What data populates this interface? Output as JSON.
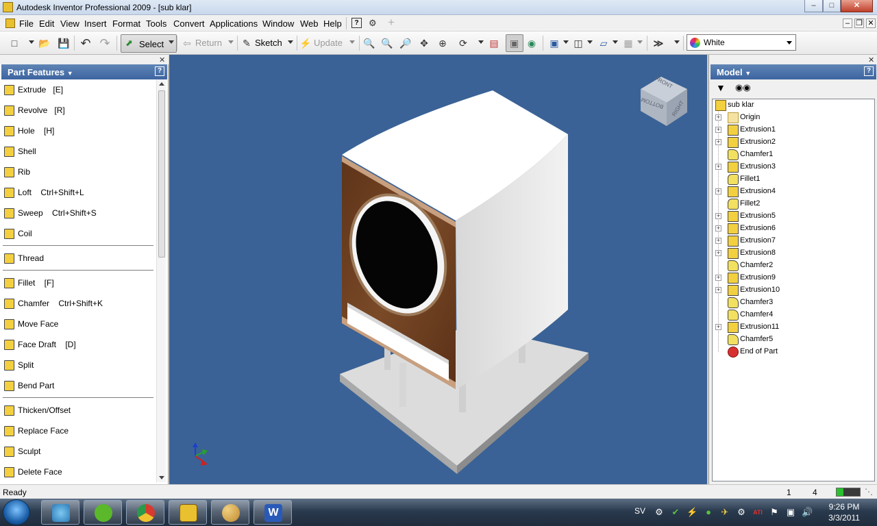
{
  "window": {
    "title": "Autodesk Inventor Professional 2009 - [sub klar]"
  },
  "menubar": {
    "items": [
      "File",
      "Edit",
      "View",
      "Insert",
      "Format",
      "Tools",
      "Convert",
      "Applications",
      "Window",
      "Web",
      "Help"
    ]
  },
  "toolbar": {
    "select_label": "Select",
    "return_label": "Return",
    "sketch_label": "Sketch",
    "update_label": "Update",
    "color_value": "White"
  },
  "left_panel": {
    "title": "Part Features",
    "items": [
      {
        "label": "Extrude   [E]",
        "icon": "extrude-icon"
      },
      {
        "label": "Revolve   [R]",
        "icon": "revolve-icon"
      },
      {
        "label": "Hole    [H]",
        "icon": "hole-icon"
      },
      {
        "label": "Shell",
        "icon": "shell-icon"
      },
      {
        "label": "Rib",
        "icon": "rib-icon"
      },
      {
        "label": "Loft    Ctrl+Shift+L",
        "icon": "loft-icon"
      },
      {
        "label": "Sweep    Ctrl+Shift+S",
        "icon": "sweep-icon"
      },
      {
        "label": "Coil",
        "icon": "coil-icon"
      },
      {
        "label": "Thread",
        "icon": "thread-icon"
      },
      {
        "label": "Fillet    [F]",
        "icon": "fillet-icon"
      },
      {
        "label": "Chamfer    Ctrl+Shift+K",
        "icon": "chamfer-icon"
      },
      {
        "label": "Move Face",
        "icon": "move-face-icon"
      },
      {
        "label": "Face Draft    [D]",
        "icon": "face-draft-icon"
      },
      {
        "label": "Split",
        "icon": "split-icon"
      },
      {
        "label": "Bend Part",
        "icon": "bend-part-icon"
      },
      {
        "label": "Thicken/Offset",
        "icon": "thicken-icon"
      },
      {
        "label": "Replace Face",
        "icon": "replace-face-icon"
      },
      {
        "label": "Sculpt",
        "icon": "sculpt-icon"
      },
      {
        "label": "Delete Face",
        "icon": "delete-face-icon"
      }
    ]
  },
  "viewcube": {
    "faces": [
      "FRONT",
      "RIGHT",
      "BOTTOM"
    ]
  },
  "right_panel": {
    "title": "Model",
    "tree": [
      {
        "label": "sub klar",
        "type": "part"
      },
      {
        "label": "Origin",
        "type": "folder"
      },
      {
        "label": "Extrusion1",
        "type": "extrusion"
      },
      {
        "label": "Extrusion2",
        "type": "extrusion"
      },
      {
        "label": "Chamfer1",
        "type": "chamfer"
      },
      {
        "label": "Extrusion3",
        "type": "extrusion"
      },
      {
        "label": "Fillet1",
        "type": "fillet"
      },
      {
        "label": "Extrusion4",
        "type": "extrusion"
      },
      {
        "label": "Fillet2",
        "type": "fillet"
      },
      {
        "label": "Extrusion5",
        "type": "extrusion"
      },
      {
        "label": "Extrusion6",
        "type": "extrusion"
      },
      {
        "label": "Extrusion7",
        "type": "extrusion"
      },
      {
        "label": "Extrusion8",
        "type": "extrusion"
      },
      {
        "label": "Chamfer2",
        "type": "chamfer"
      },
      {
        "label": "Extrusion9",
        "type": "extrusion"
      },
      {
        "label": "Extrusion10",
        "type": "extrusion"
      },
      {
        "label": "Chamfer3",
        "type": "chamfer"
      },
      {
        "label": "Chamfer4",
        "type": "chamfer"
      },
      {
        "label": "Extrusion11",
        "type": "extrusion"
      },
      {
        "label": "Chamfer5",
        "type": "chamfer"
      },
      {
        "label": "End of Part",
        "type": "end"
      }
    ]
  },
  "statusbar": {
    "text": "Ready",
    "count1": "1",
    "count2": "4"
  },
  "taskbar": {
    "apps": [
      "Windows Live Messenger",
      "Spotify",
      "Google Chrome",
      "Autodesk Inventor",
      "Paint",
      "Microsoft Word"
    ],
    "language": "SV",
    "time": "9:26 PM",
    "date": "3/3/2011"
  },
  "colors": {
    "viewport_bg": "#3a6296",
    "panel_header": "#3d64a0",
    "wood": "#6b3d20"
  }
}
